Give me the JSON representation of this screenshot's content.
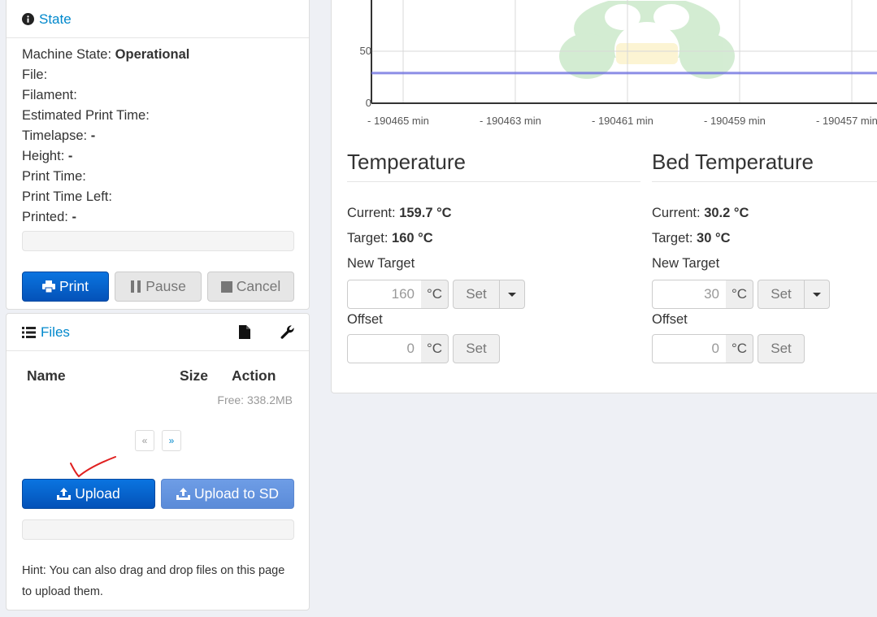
{
  "state_panel": {
    "title": "State",
    "machine_state_label": "Machine State:",
    "machine_state_value": "Operational",
    "file_label": "File:",
    "filament_label": "Filament:",
    "estimated_label": "Estimated Print Time:",
    "timelapse_label": "Timelapse:",
    "timelapse_value": "-",
    "height_label": "Height:",
    "height_value": "-",
    "print_time_label": "Print Time:",
    "print_time_left_label": "Print Time Left:",
    "printed_label": "Printed:",
    "printed_value": "-",
    "progress": 0,
    "print_button": "Print",
    "pause_button": "Pause",
    "cancel_button": "Cancel"
  },
  "files_panel": {
    "title": "Files",
    "columns": [
      "Name",
      "Size",
      "Action"
    ],
    "free_space": "Free: 338.2MB",
    "pager_prev": "«",
    "pager_next": "»",
    "upload_button": "Upload",
    "upload_sd_button": "Upload to SD",
    "upload_progress": 0,
    "hint_line1": "Hint: You can also drag and drop files on this page",
    "hint_line2": "to upload them."
  },
  "graph": {
    "y_ticks": [
      "50",
      "0"
    ],
    "x_ticks": [
      "- 190465 min",
      "- 190463 min",
      "- 190461 min",
      "- 190459 min",
      "- 190457 min"
    ],
    "series": [
      {
        "values": [
          29,
          29,
          29,
          29,
          29
        ],
        "color": "#6f72e0"
      }
    ]
  },
  "temperature": {
    "title": "Temperature",
    "current_label": "Current:",
    "current_value": "159.7 °C",
    "target_label": "Target:",
    "target_value": "160 °C",
    "new_target_label": "New Target",
    "new_target_placeholder": "160",
    "unit": "°C",
    "set_label": "Set",
    "offset_label": "Offset",
    "offset_placeholder": "0"
  },
  "bed_temperature": {
    "title": "Bed Temperature",
    "current_label": "Current:",
    "current_value": "30.2 °C",
    "target_label": "Target:",
    "target_value": "30 °C",
    "new_target_label": "New Target",
    "new_target_placeholder": "30",
    "unit": "°C",
    "set_label": "Set",
    "offset_label": "Offset",
    "offset_placeholder": "0"
  },
  "colors": {
    "accent": "#0088cc",
    "primary_button": "#0452b8",
    "annotation_mark": "#e02020"
  }
}
